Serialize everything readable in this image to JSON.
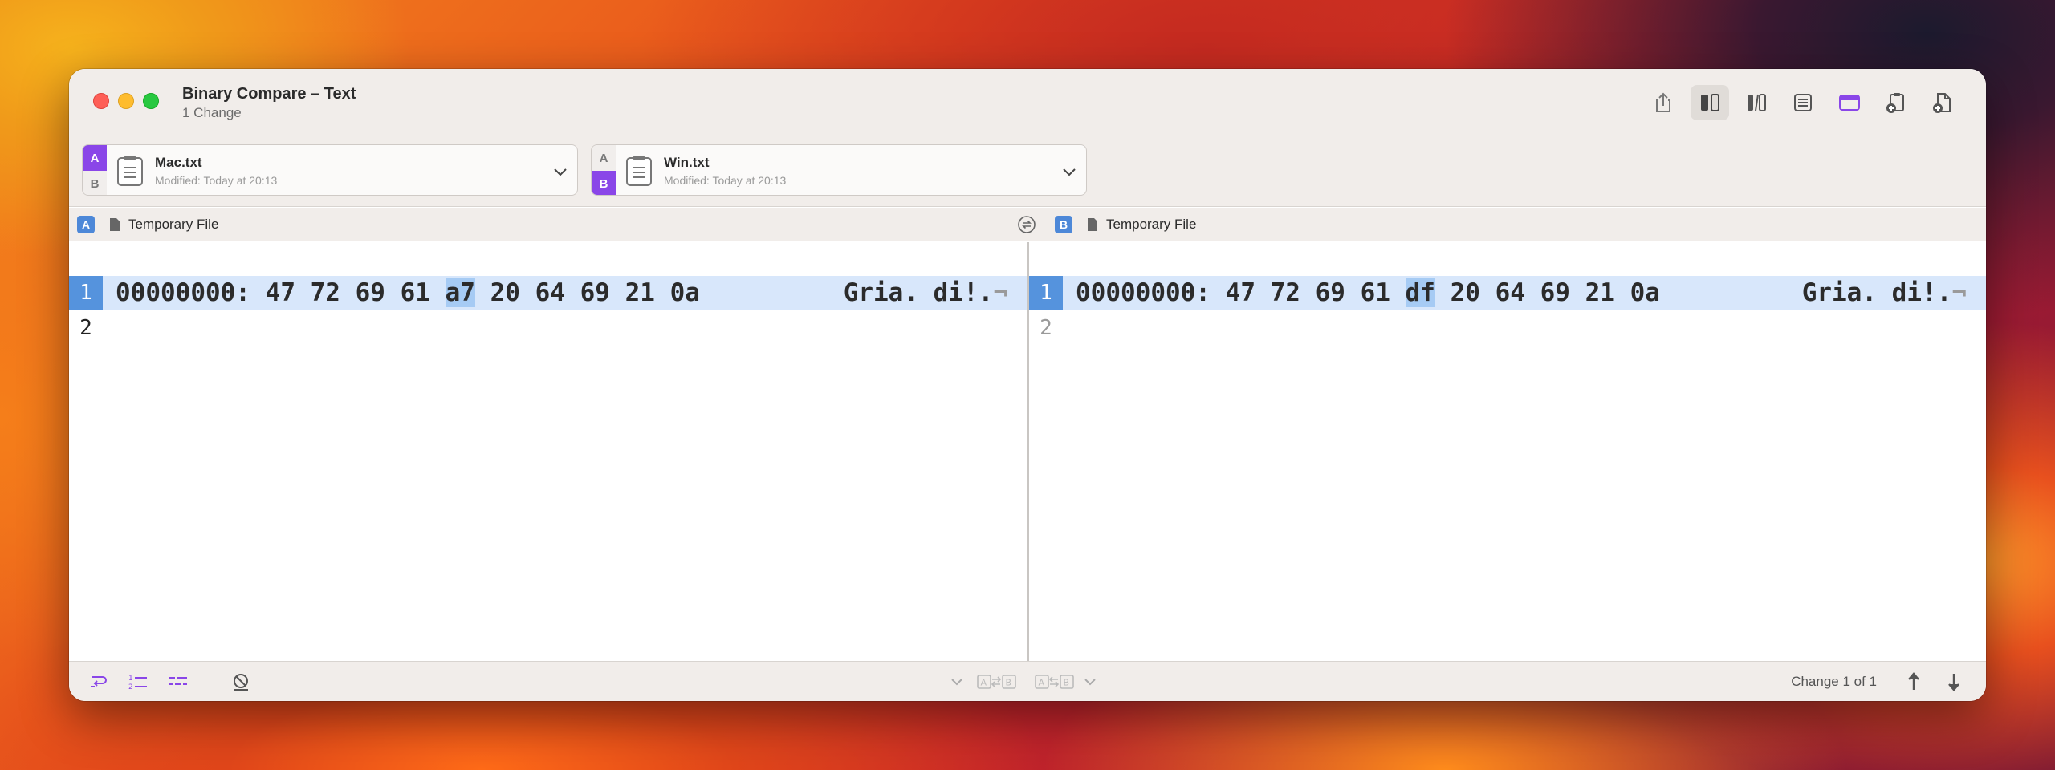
{
  "window": {
    "title": "Binary Compare – Text",
    "subtitle": "1 Change"
  },
  "toolbar": {
    "icons": [
      "share-icon",
      "two-pane-icon",
      "three-pane-icon",
      "unified-icon",
      "window-layout-icon",
      "clipboard-add-icon",
      "file-add-icon"
    ],
    "accent": "#8a46e8"
  },
  "files": {
    "left": {
      "a_label": "A",
      "b_label": "B",
      "name": "Mac.txt",
      "modified": "Modified: Today at 20:13"
    },
    "right": {
      "a_label": "A",
      "b_label": "B",
      "name": "Win.txt",
      "modified": "Modified: Today at 20:13"
    }
  },
  "pathbar": {
    "left": {
      "badge": "A",
      "label": "Temporary File"
    },
    "right": {
      "badge": "B",
      "label": "Temporary File"
    }
  },
  "left_pane": {
    "lines": [
      {
        "number": "1",
        "offset": "00000000:",
        "hex_before": "47 72 69 61",
        "hex_diff": "a7",
        "hex_after": "20 64 69 21 0a",
        "ascii": "Gria. di!.",
        "eol": "¬"
      },
      {
        "number": "2"
      }
    ]
  },
  "right_pane": {
    "lines": [
      {
        "number": "1",
        "offset": "00000000:",
        "hex_before": "47 72 69 61",
        "hex_diff": "df",
        "hex_after": "20 64 69 21 0a",
        "ascii": "Gria. di!.",
        "eol": "¬"
      },
      {
        "number": "2"
      }
    ]
  },
  "statusbar": {
    "change_text": "Change 1 of 1",
    "highlight_color": "#a6cbf4",
    "changed_row_color": "#d8e7fb"
  }
}
